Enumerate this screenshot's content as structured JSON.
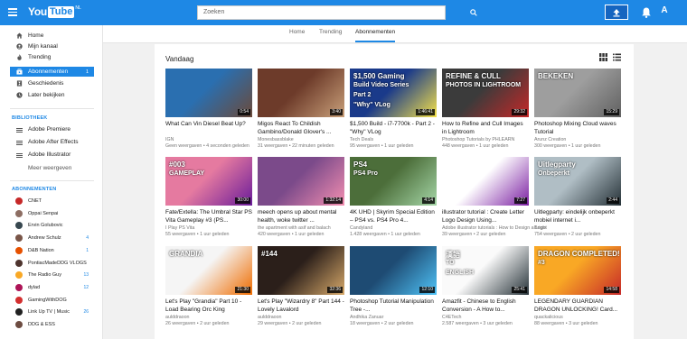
{
  "header": {
    "logo_you": "You",
    "logo_tube": "Tube",
    "logo_region": "NL",
    "search_placeholder": "Zoeken",
    "avatar_letter": "A"
  },
  "sidebar": {
    "main_items": [
      {
        "label": "Home",
        "icon": "home-icon"
      },
      {
        "label": "Mijn kanaal",
        "icon": "person-icon"
      },
      {
        "label": "Trending",
        "icon": "flame-icon"
      },
      {
        "label": "Abonnementen",
        "icon": "subscriptions-icon",
        "count": "1",
        "active": true
      },
      {
        "label": "Geschiedenis",
        "icon": "history-icon"
      },
      {
        "label": "Later bekijken",
        "icon": "clock-icon"
      }
    ],
    "library_title": "BIBLIOTHEEK",
    "library_items": [
      {
        "label": "Adobe Premiere"
      },
      {
        "label": "Adobe After Effects"
      },
      {
        "label": "Adobe Illustrator"
      }
    ],
    "more_label": "Meer weergeven",
    "subs_title": "ABONNEMENTEN",
    "subscriptions": [
      {
        "label": "CNET",
        "color": "#c62828",
        "count": ""
      },
      {
        "label": "Oppai Senpai",
        "color": "#8d6e63",
        "count": ""
      },
      {
        "label": "Ervin Golubovic",
        "color": "#37474f",
        "count": ""
      },
      {
        "label": "Andrew Schulz",
        "color": "#795548",
        "count": "4"
      },
      {
        "label": "D&B Nation",
        "color": "#e65100",
        "count": "1"
      },
      {
        "label": "PontiacMadeDDG VLOGS",
        "color": "#4e342e",
        "count": ""
      },
      {
        "label": "The Radio Guy",
        "color": "#f9a825",
        "count": "13"
      },
      {
        "label": "dylad",
        "color": "#ad1457",
        "count": "12"
      },
      {
        "label": "GamingWithDOG",
        "color": "#d32f2f",
        "count": ""
      },
      {
        "label": "Link Up TV | Music",
        "color": "#212121",
        "count": "26"
      },
      {
        "label": "DDG & ESS",
        "color": "#6d4c41",
        "count": ""
      }
    ]
  },
  "tabs": [
    {
      "label": "Home"
    },
    {
      "label": "Trending"
    },
    {
      "label": "Abonnementen",
      "active": true
    }
  ],
  "main": {
    "section_title": "Vandaag",
    "videos": [
      {
        "title": "What Can Vin Diesel Beat Up?",
        "channel": "IGN",
        "meta": "Geen weergaven • 4 seconden geleden",
        "duration": "0:54",
        "bg": "#2a6fb0",
        "accent": "#6b4a3a"
      },
      {
        "title": "Migos React To Childish Gambino/Donald Glover's ...",
        "channel": "Monesbassblake",
        "meta": "31 weergaven • 22 minuten geleden",
        "duration": "3:40",
        "bg": "#6d3b2a",
        "accent": "#c9a07a"
      },
      {
        "title": "$1,500 Build - i7-7700k - Part 2 - \"Why\" VLog",
        "channel": "Tech Deals",
        "meta": "95 weergaven • 1 uur geleden",
        "duration": "1:46:41",
        "bg": "#1a3a8a",
        "accent": "#f5e24a",
        "overlay1": "$1,500 Gaming",
        "overlay2": "Build Video Series",
        "overlay3": "Part 2",
        "overlay4": "\"Why\" VLog"
      },
      {
        "title": "How to Refine and Cull Images in Lightroom",
        "channel": "Photoshop Tutorials by PHLEARN",
        "meta": "448 weergaven • 1 uur geleden",
        "duration": "29:32",
        "bg": "#3b3b3b",
        "accent": "#c62828",
        "overlay1": "REFINE & CULL",
        "overlay2": "PHOTOS IN LIGHTROOM"
      },
      {
        "title": "Photoshop Mixing Cloud waves Tutorial",
        "channel": "Arunz Creation",
        "meta": "300 weergaven • 1 uur geleden",
        "duration": "15:29",
        "bg": "#9e9e9e",
        "accent": "#616161",
        "overlay1": "BEKEKEN"
      },
      {
        "title": "Fate/Extella: The Umbral Star PS Vita Gameplay #3 (PS...",
        "channel": "I Play PS Vita",
        "meta": "55 weergaven • 1 uur geleden",
        "duration": "30:00",
        "bg": "#e57aa0",
        "accent": "#6a1b9a",
        "overlay1": "#003",
        "overlay2": "GAMEPLAY"
      },
      {
        "title": "meech opens up about mental health, woke twitter ...",
        "channel": "the apartment with asif and balach",
        "meta": "420 weergaven • 1 uur geleden",
        "duration": "1:32:14",
        "bg": "#7b4a8a",
        "accent": "#f48fb1"
      },
      {
        "title": "4K UHD | Skyrim Special Edition – PS4 vs. PS4 Pro 4...",
        "channel": "Candyland",
        "meta": "1.428 weergaven • 1 uur geleden",
        "duration": "4:14",
        "bg": "#4c6e3a",
        "accent": "#a5d6a7",
        "overlay1": "PS4",
        "overlay2": "PS4 Pro"
      },
      {
        "title": "illustrator tutorial : Create Letter Logo Design Using...",
        "channel": "Adobe illustrator tutorials : How to Design a Logo",
        "meta": "39 weergaven • 2 uur geleden",
        "duration": "7:27",
        "bg": "#ffffff",
        "accent": "#7b1fa2"
      },
      {
        "title": "Uitlegparty: eindelijk onbeperkt mobiel internet i...",
        "channel": "Bright",
        "meta": "754 weergaven • 2 uur geleden",
        "duration": "2:44",
        "bg": "#b0bec5",
        "accent": "#263238",
        "overlay1": "Uitlegparty",
        "overlay2": "Onbeperkt"
      },
      {
        "title": "Let's Play \"Grandia\" Part 10 - Load Bearing Orc King",
        "channel": "aulddraoon",
        "meta": "26 weergaven • 2 uur geleden",
        "duration": "21:30",
        "bg": "#f5f5f5",
        "accent": "#ef6c00",
        "overlay1": "GRANDIA"
      },
      {
        "title": "Let's Play \"Wizardry 8\" Part 144 - Lovely Lavalord",
        "channel": "aulddraoon",
        "meta": "29 weergaven • 2 uur geleden",
        "duration": "32:36",
        "bg": "#2b1f1a",
        "accent": "#d7a96a",
        "overlay1": "#144"
      },
      {
        "title": "Photoshop Tutorial Manipulation Tree -...",
        "channel": "Andhika Zanuar",
        "meta": "18 weergaven • 2 uur geleden",
        "duration": "12:10",
        "bg": "#1e4b73",
        "accent": "#4fc3f7"
      },
      {
        "title": "Amazfit - Chinese to English Conversion - A How to...",
        "channel": "C4ETech",
        "meta": "2.587 weergaven • 3 uur geleden",
        "duration": "25:41",
        "bg": "#fafafa",
        "accent": "#263238",
        "overlay1": "漢語",
        "overlay2": "TO",
        "overlay3": "ENGLISH"
      },
      {
        "title": "LEGENDARY GUARDIAN DRAGON UNLOCKING! Card...",
        "channel": "quackalicious",
        "meta": "88 weergaven • 3 uur geleden",
        "duration": "14:58",
        "bg": "#f9a825",
        "accent": "#c62828",
        "overlay1": "DRAGON COMPLETED!",
        "overlay2": "#3"
      }
    ]
  },
  "colors": {
    "accent": "#1e88e5",
    "header": "#1e88e5"
  }
}
